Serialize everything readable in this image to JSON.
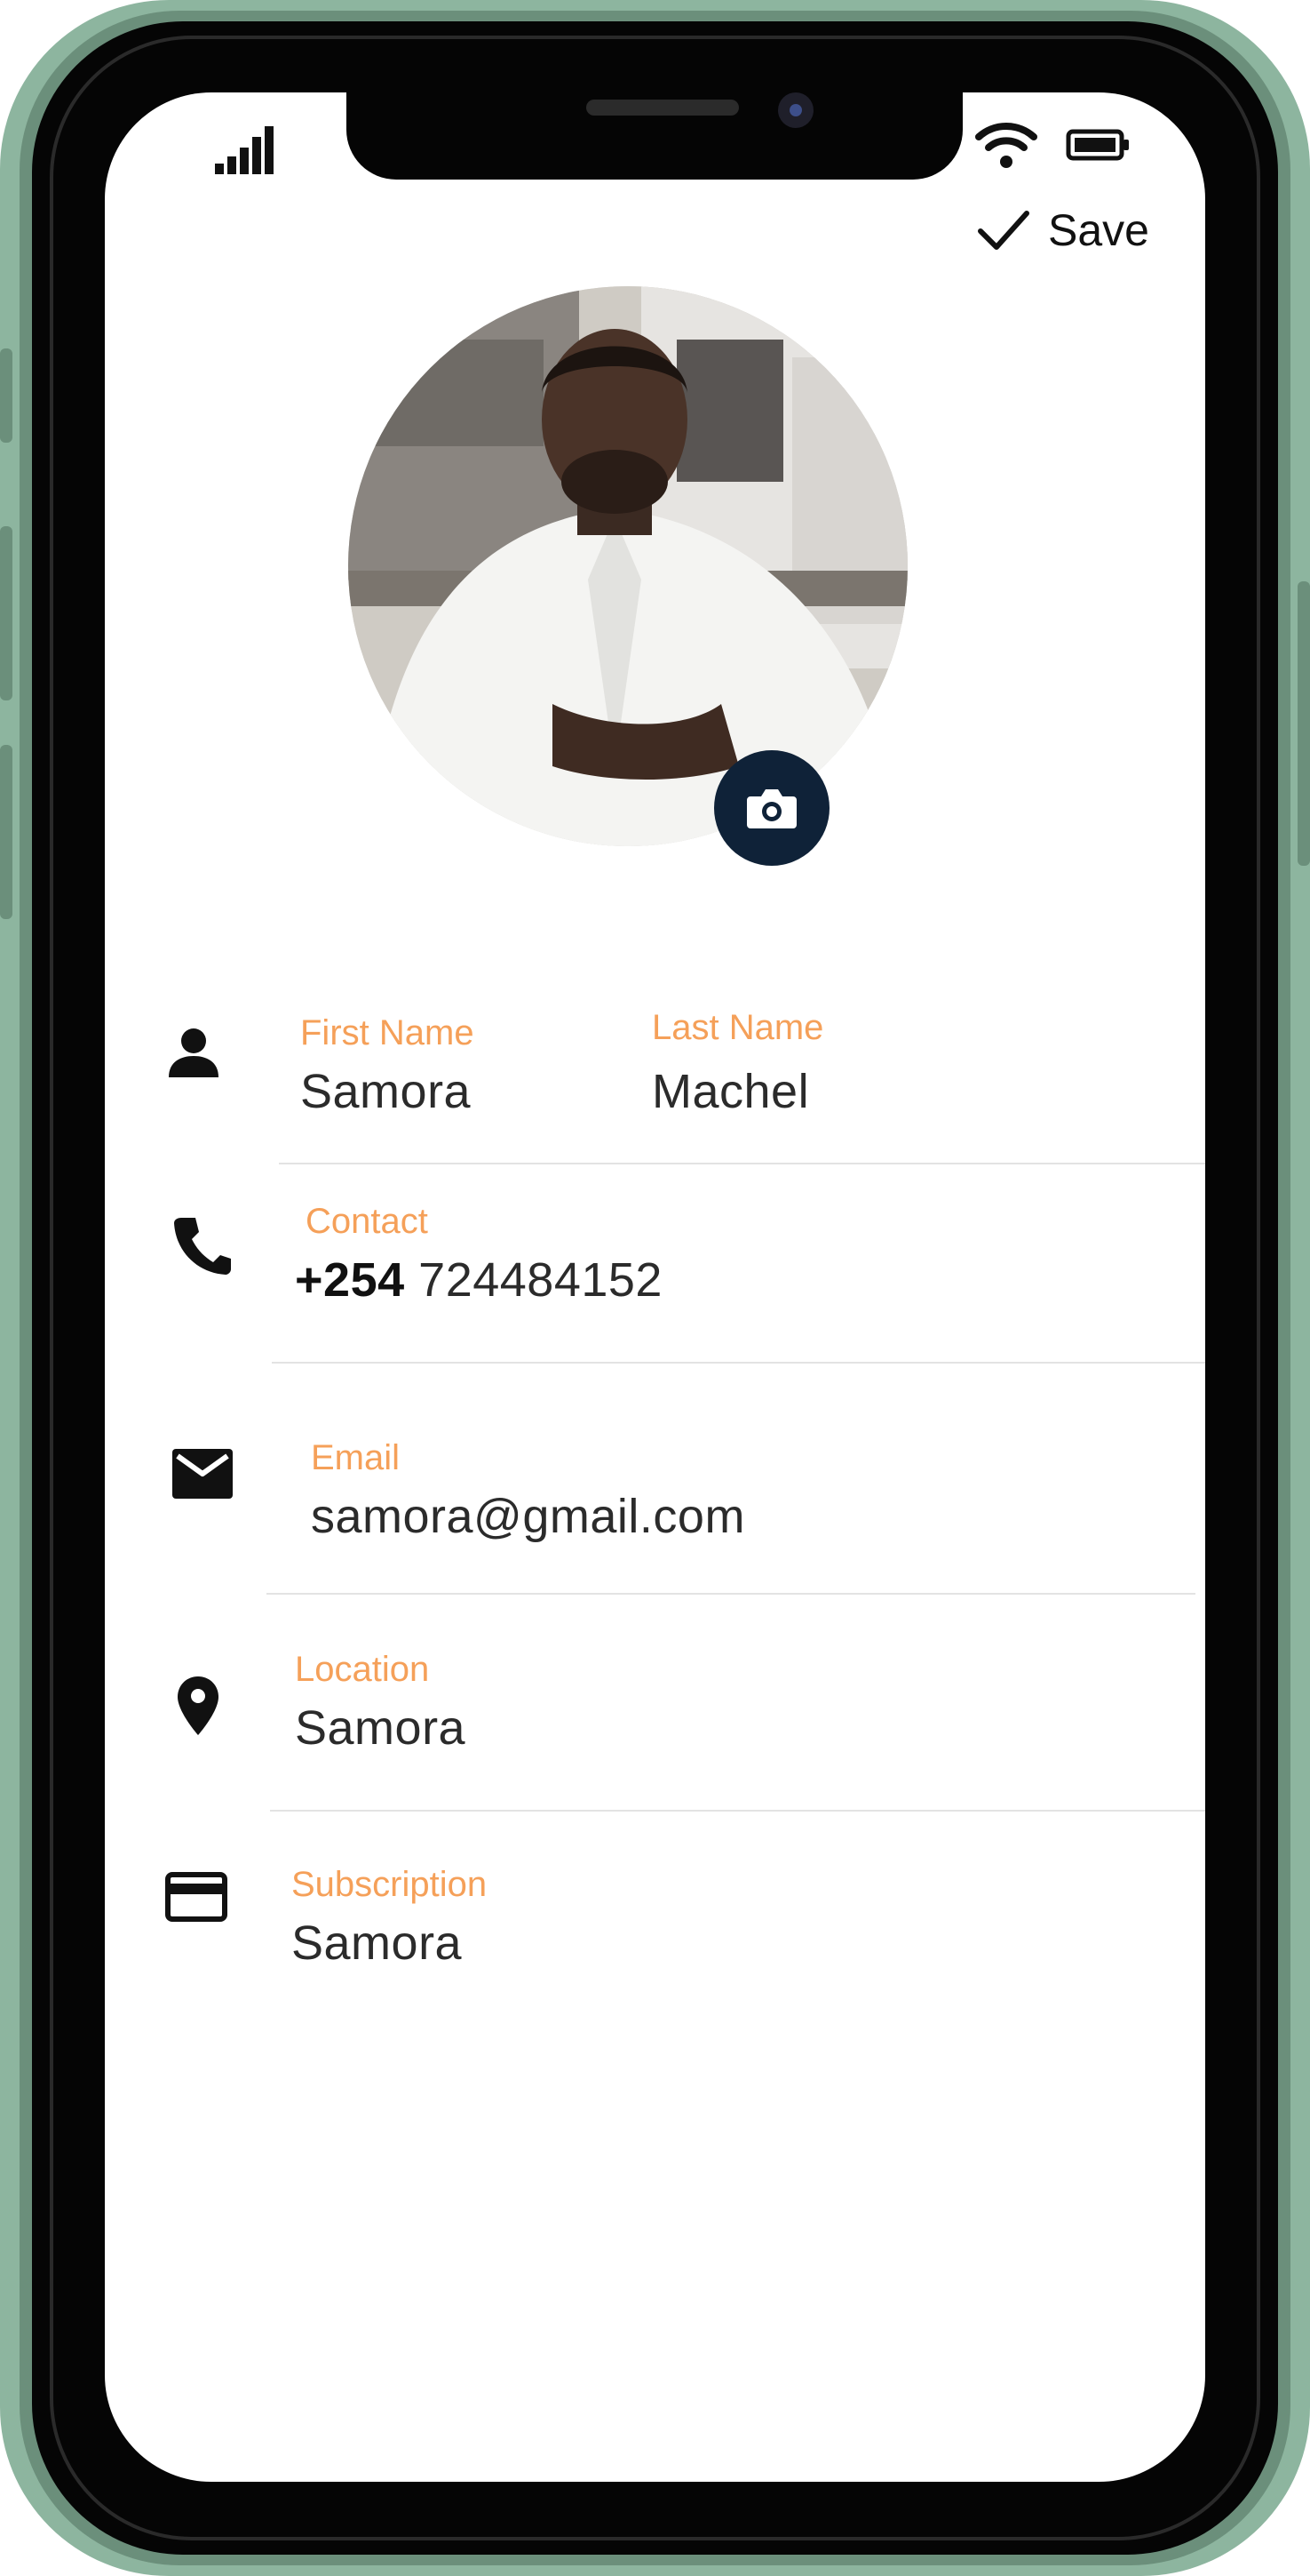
{
  "header": {
    "save_label": "Save"
  },
  "profile": {
    "first_name_label": "First Name",
    "first_name": "Samora",
    "last_name_label": "Last Name",
    "last_name": "Machel",
    "contact_label": "Contact",
    "country_code": "+254",
    "phone_number": "724484152",
    "email_label": "Email",
    "email": "samora@gmail.com",
    "location_label": "Location",
    "location": "Samora",
    "subscription_label": "Subscription",
    "subscription": "Samora"
  },
  "icons": {
    "status": [
      "signal-icon",
      "wifi-icon",
      "battery-icon"
    ],
    "save": "check-icon",
    "camera": "camera-icon",
    "fields": [
      "person-icon",
      "phone-icon",
      "email-icon",
      "location-pin-icon",
      "credit-card-icon"
    ]
  },
  "colors": {
    "label_accent": "#f5a059",
    "camera_button": "#0f2238",
    "phone_frame": "#8db59f"
  }
}
